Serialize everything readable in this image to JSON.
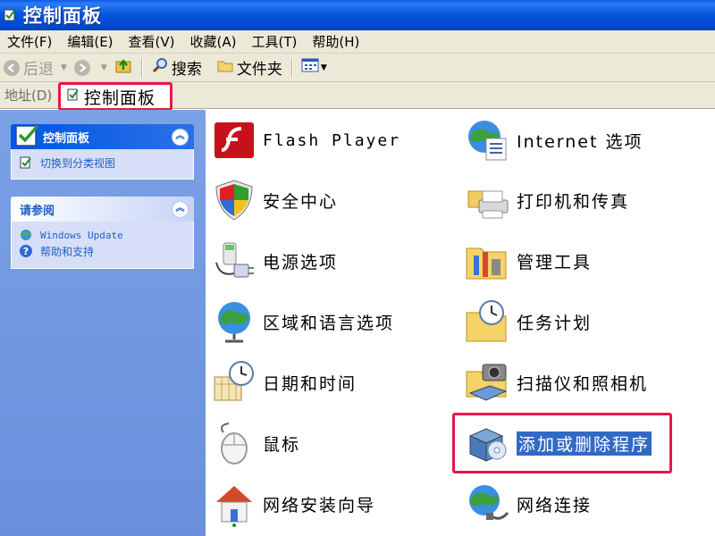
{
  "window": {
    "title": "控制面板"
  },
  "menu": [
    "文件(F)",
    "编辑(E)",
    "查看(V)",
    "收藏(A)",
    "工具(T)",
    "帮助(H)"
  ],
  "toolbar": {
    "back": "后退",
    "search": "搜索",
    "folders": "文件夹"
  },
  "address": {
    "label": "地址(D)",
    "value": "控制面板"
  },
  "sidebar": {
    "panel1": {
      "title": "控制面板",
      "task": "切换到分类视图"
    },
    "panel2": {
      "title": "请参阅",
      "links": [
        "Windows Update",
        "帮助和支持"
      ]
    }
  },
  "items": [
    {
      "label": "Flash Player",
      "icon": "flash-icon"
    },
    {
      "label": "Internet 选项",
      "icon": "globe-settings-icon"
    },
    {
      "label": "安全中心",
      "icon": "shield-icon"
    },
    {
      "label": "打印机和传真",
      "icon": "printer-icon"
    },
    {
      "label": "电源选项",
      "icon": "power-plug-icon"
    },
    {
      "label": "管理工具",
      "icon": "tools-folder-icon"
    },
    {
      "label": "区域和语言选项",
      "icon": "globe-icon"
    },
    {
      "label": "任务计划",
      "icon": "clock-folder-icon"
    },
    {
      "label": "日期和时间",
      "icon": "calendar-clock-icon"
    },
    {
      "label": "扫描仪和照相机",
      "icon": "camera-scanner-icon"
    },
    {
      "label": "鼠标",
      "icon": "mouse-icon"
    },
    {
      "label": "添加或删除程序",
      "icon": "add-remove-programs-icon"
    },
    {
      "label": "网络安装向导",
      "icon": "home-network-icon"
    },
    {
      "label": "网络连接",
      "icon": "network-globe-icon"
    }
  ],
  "colors": {
    "titlebar": "#0054e3",
    "selection": "#316ac5",
    "highlight_box": "#e8174b"
  }
}
